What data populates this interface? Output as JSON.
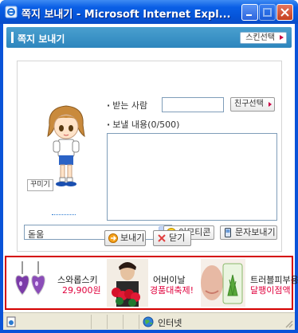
{
  "window": {
    "title": "쪽지 보내기 - Microsoft Internet Expl...",
    "colors": {
      "titlebar": "#0a5fe6",
      "header": "#3a93c8",
      "ad_border": "#d40000"
    }
  },
  "header": {
    "title": "쪽지 보내기",
    "skin_button": "스킨선택"
  },
  "avatar": {
    "decorate_button": "꾸미기"
  },
  "form": {
    "recipient_label": "받는 사람",
    "recipient_value": "",
    "friend_select_button": "친구선택",
    "message_label": "보낼 내용(0/500)",
    "message_value": "",
    "font_select": {
      "selected": "돋움"
    },
    "emoticon_button": "이모티콘",
    "sms_button": "문자보내기"
  },
  "actions": {
    "send_button": "보내기",
    "close_button": "닫기"
  },
  "ad": {
    "items": [
      {
        "line1": "스와롭스키",
        "line2": "29,900원",
        "image": "earrings"
      },
      {
        "line1": "어버이날",
        "line2": "경품대축제!",
        "image": "carnations"
      },
      {
        "line1": "트러블피부용",
        "line2": "달팽이점액",
        "image": "aloe-cosmetic"
      }
    ]
  },
  "status": {
    "zone": "인터넷"
  }
}
